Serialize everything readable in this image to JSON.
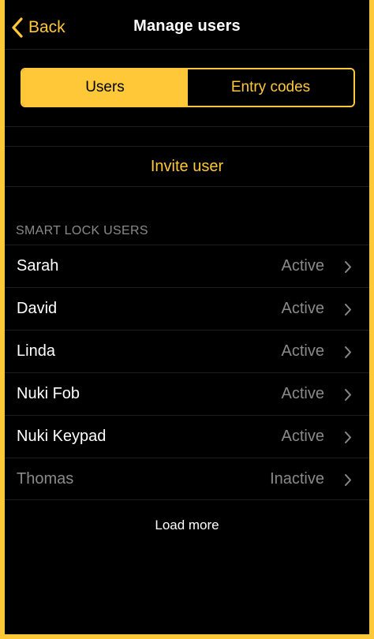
{
  "colors": {
    "accent": "#ffc839",
    "background": "#000000",
    "text": "#ffffff",
    "muted": "#8a8a8a"
  },
  "nav": {
    "back_label": "Back",
    "title": "Manage users",
    "back_icon": "chevron-left-icon"
  },
  "segments": [
    {
      "label": "Users",
      "selected": true
    },
    {
      "label": "Entry codes",
      "selected": false
    }
  ],
  "invite_label": "Invite user",
  "section_header": "SMART LOCK USERS",
  "users": [
    {
      "name": "Sarah",
      "status": "Active"
    },
    {
      "name": "David",
      "status": "Active"
    },
    {
      "name": "Linda",
      "status": "Active"
    },
    {
      "name": "Nuki Fob",
      "status": "Active"
    },
    {
      "name": "Nuki Keypad",
      "status": "Active"
    },
    {
      "name": "Thomas",
      "status": "Inactive"
    }
  ],
  "load_more_label": "Load more",
  "row_icon": "chevron-right-icon"
}
